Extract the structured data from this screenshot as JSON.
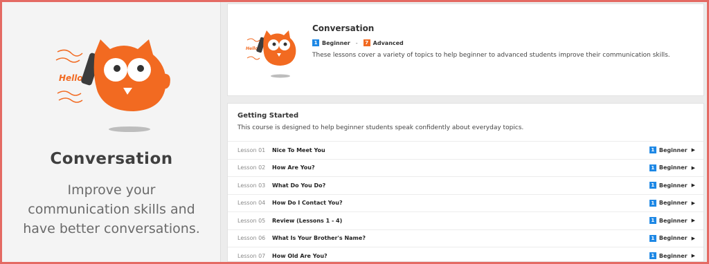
{
  "promo": {
    "title": "Conversation",
    "description": "Improve your communication skills and have better conversations.",
    "mascot_caption": "Hello!",
    "mascot_icon": "owl-mascot-on-phone-icon"
  },
  "course": {
    "title": "Conversation",
    "level_start": {
      "number": "1",
      "label": "Beginner",
      "color": "#1e88e5"
    },
    "level_separator": "-",
    "level_end": {
      "number": "7",
      "label": "Advanced",
      "color": "#f26a21"
    },
    "description": "These lessons cover a variety of topics to help beginner to advanced students improve their communication skills."
  },
  "section": {
    "title": "Getting Started",
    "description": "This course is designed to help beginner students speak confidently about everyday topics.",
    "lessons": [
      {
        "number": "Lesson 01",
        "title": "Nice To Meet You",
        "level_num": "1",
        "level": "Beginner"
      },
      {
        "number": "Lesson 02",
        "title": "How Are You?",
        "level_num": "1",
        "level": "Beginner"
      },
      {
        "number": "Lesson 03",
        "title": "What Do You Do?",
        "level_num": "1",
        "level": "Beginner"
      },
      {
        "number": "Lesson 04",
        "title": "How Do I Contact You?",
        "level_num": "1",
        "level": "Beginner"
      },
      {
        "number": "Lesson 05",
        "title": "Review (Lessons 1 - 4)",
        "level_num": "1",
        "level": "Beginner"
      },
      {
        "number": "Lesson 06",
        "title": "What Is Your Brother's Name?",
        "level_num": "1",
        "level": "Beginner"
      },
      {
        "number": "Lesson 07",
        "title": "How Old Are You?",
        "level_num": "1",
        "level": "Beginner"
      }
    ]
  },
  "colors": {
    "accent_orange": "#f26a21",
    "beginner_blue": "#1e88e5",
    "frame_border": "#e46a63"
  }
}
